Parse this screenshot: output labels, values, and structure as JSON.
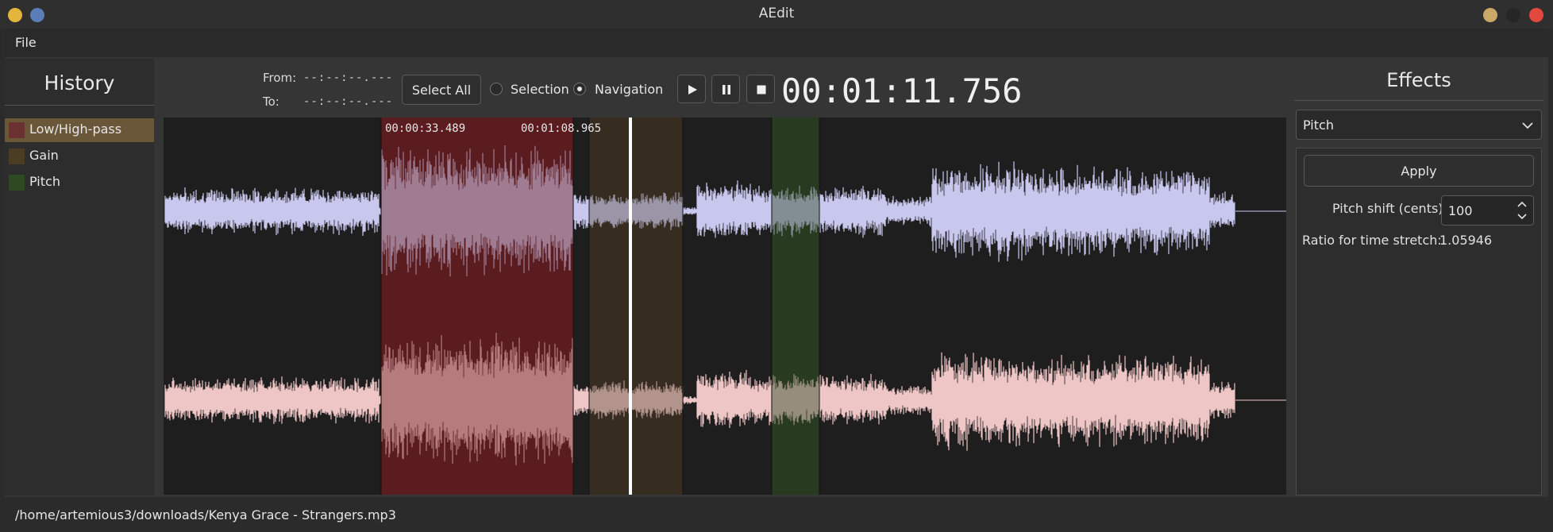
{
  "window": {
    "title": "AEdit"
  },
  "menu": {
    "file_label": "File"
  },
  "history": {
    "title": "History",
    "items": [
      {
        "label": "Low/High-pass",
        "color": "#6b3030",
        "selected": true
      },
      {
        "label": "Gain",
        "color": "#4a3d22",
        "selected": false
      },
      {
        "label": "Pitch",
        "color": "#2d4a22",
        "selected": false
      }
    ]
  },
  "transport": {
    "from_label": "From:",
    "from_value": "--:--:--.---",
    "to_label": "To:",
    "to_value": "--:--:--.---",
    "select_all_label": "Select All",
    "selection_label": "Selection",
    "navigation_label": "Navigation",
    "mode": "navigation",
    "current_time": "00:01:11.756"
  },
  "waveform": {
    "region_start": "00:00:33.489",
    "region_end": "00:01:08.965",
    "top_channel_color": "#c8c8ef",
    "bottom_channel_color": "#efc6c6"
  },
  "effects": {
    "title": "Effects",
    "selected_effect": "Pitch",
    "apply_label": "Apply",
    "pitch_shift_label": "Pitch shift (cents)",
    "pitch_shift_value": "100",
    "ratio_label": "Ratio for time stretch:",
    "ratio_value": "1.05946"
  },
  "status": {
    "file_path": "/home/artemious3/downloads/Kenya Grace - Strangers.mp3"
  }
}
